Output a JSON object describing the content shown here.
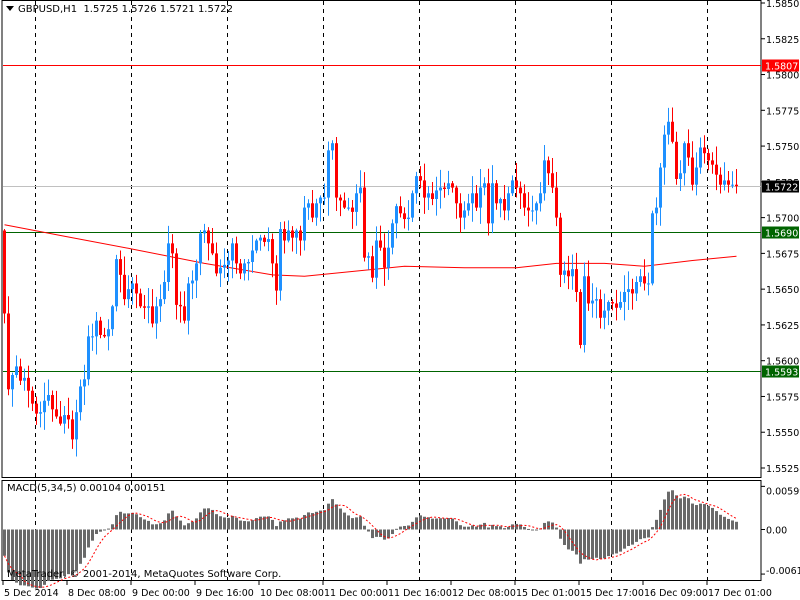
{
  "header": {
    "symbol": "GBPUSD,H1",
    "ohlc": "1.5725 1.5726 1.5721 1.5722"
  },
  "macd": {
    "label": "MACD(5,34,5) 0.00104 0.00151",
    "axis_labels": [
      "0.00599",
      "0.00",
      "-0.00619"
    ],
    "axis_values": [
      0.00599,
      0,
      -0.00619
    ]
  },
  "copyright": "MetaTrader, © 2001-2014, MetaQuotes Software Corp.",
  "colors": {
    "bull": "#1E90FF",
    "bear": "#FF0000",
    "ma": "#FF0000",
    "resistance": "#FF0000",
    "support": "#006400",
    "current": "#C0C0C0",
    "macd_hist": "#696969",
    "macd_signal": "#FF0000"
  },
  "chart_data": {
    "type": "candlestick",
    "symbol": "GBPUSD",
    "timeframe": "H1",
    "ylim": [
      1.5525,
      1.585
    ],
    "price_ticks": [
      "1.5850",
      "1.5825",
      "1.5800",
      "1.5775",
      "1.5750",
      "1.5725",
      "1.5700",
      "1.5675",
      "1.5650",
      "1.5625",
      "1.5600",
      "1.5575",
      "1.5550",
      "1.5525"
    ],
    "price_levels": [
      {
        "label": "1.5807",
        "value": 1.5807,
        "kind": "resistance"
      },
      {
        "label": "1.5722",
        "value": 1.5722,
        "kind": "current"
      },
      {
        "label": "1.5690",
        "value": 1.569,
        "kind": "support"
      },
      {
        "label": "1.5593",
        "value": 1.5593,
        "kind": "support"
      }
    ],
    "x_labels": [
      {
        "bar": 0,
        "label": "5 Dec 2014"
      },
      {
        "bar": 16,
        "label": "8 Dec 08:00"
      },
      {
        "bar": 32,
        "label": "9 Dec 00:00"
      },
      {
        "bar": 48,
        "label": "9 Dec 16:00"
      },
      {
        "bar": 64,
        "label": "10 Dec 08:00"
      },
      {
        "bar": 80,
        "label": "11 Dec 00:00"
      },
      {
        "bar": 96,
        "label": "11 Dec 16:00"
      },
      {
        "bar": 112,
        "label": "12 Dec 08:00"
      },
      {
        "bar": 128,
        "label": "15 Dec 01:00"
      },
      {
        "bar": 144,
        "label": "15 Dec 17:00"
      },
      {
        "bar": 160,
        "label": "16 Dec 09:00"
      },
      {
        "bar": 176,
        "label": "17 Dec 01:00"
      }
    ],
    "first_open": 1.5691,
    "closes": [
      1.5633,
      1.558,
      1.559,
      1.5596,
      1.5586,
      1.5588,
      1.5579,
      1.557,
      1.5563,
      1.5564,
      1.5572,
      1.5576,
      1.5566,
      1.5561,
      1.5556,
      1.5562,
      1.5559,
      1.5545,
      1.5564,
      1.5582,
      1.5587,
      1.5617,
      1.5617,
      1.5628,
      1.5618,
      1.5617,
      1.5622,
      1.5638,
      1.5671,
      1.566,
      1.5643,
      1.565,
      1.5654,
      1.5647,
      1.5638,
      1.5637,
      1.5638,
      1.5626,
      1.5638,
      1.5643,
      1.5655,
      1.5682,
      1.5675,
      1.5639,
      1.5638,
      1.5628,
      1.5654,
      1.5656,
      1.5668,
      1.5689,
      1.5691,
      1.5682,
      1.5675,
      1.5661,
      1.5665,
      1.5667,
      1.567,
      1.5682,
      1.5668,
      1.5661,
      1.5668,
      1.5669,
      1.5677,
      1.5684,
      1.5686,
      1.5683,
      1.5685,
      1.5668,
      1.5649,
      1.5692,
      1.5684,
      1.5691,
      1.5686,
      1.5691,
      1.5684,
      1.5707,
      1.571,
      1.57,
      1.571,
      1.5714,
      1.5714,
      1.5747,
      1.5752,
      1.5714,
      1.5712,
      1.5707,
      1.5707,
      1.5704,
      1.5717,
      1.5721,
      1.5672,
      1.5673,
      1.5658,
      1.5684,
      1.5679,
      1.5665,
      1.5679,
      1.5696,
      1.5708,
      1.5703,
      1.5699,
      1.57,
      1.5717,
      1.5729,
      1.5726,
      1.5714,
      1.5717,
      1.5713,
      1.5719,
      1.5721,
      1.572,
      1.5724,
      1.5721,
      1.571,
      1.57,
      1.5705,
      1.571,
      1.5717,
      1.5707,
      1.5721,
      1.5724,
      1.5696,
      1.5724,
      1.571,
      1.5713,
      1.5705,
      1.5717,
      1.5726,
      1.5721,
      1.5717,
      1.5707,
      1.5705,
      1.5705,
      1.571,
      1.5717,
      1.574,
      1.5731,
      1.5721,
      1.57,
      1.566,
      1.5663,
      1.5659,
      1.5664,
      1.5648,
      1.5611,
      1.5659,
      1.564,
      1.5642,
      1.5643,
      1.563,
      1.5635,
      1.5641,
      1.564,
      1.5637,
      1.5641,
      1.5648,
      1.565,
      1.5647,
      1.5655,
      1.5659,
      1.5654,
      1.5654,
      1.5703,
      1.5707,
      1.5735,
      1.5758,
      1.5767,
      1.5753,
      1.5727,
      1.5731,
      1.5752,
      1.5742,
      1.5723,
      1.5735,
      1.5749,
      1.5745,
      1.574,
      1.5737,
      1.573,
      1.5723,
      1.5726,
      1.5723,
      1.5723,
      1.5722
    ],
    "moving_average": [
      [
        0,
        1.5695
      ],
      [
        15,
        1.5687
      ],
      [
        32,
        1.5678
      ],
      [
        50,
        1.5668
      ],
      [
        67,
        1.566
      ],
      [
        75,
        1.5659
      ],
      [
        100,
        1.5666
      ],
      [
        115,
        1.5665
      ],
      [
        128,
        1.5665
      ],
      [
        138,
        1.5668
      ],
      [
        150,
        1.5668
      ],
      [
        160,
        1.5666
      ],
      [
        172,
        1.567
      ],
      [
        183,
        1.5673
      ]
    ]
  }
}
